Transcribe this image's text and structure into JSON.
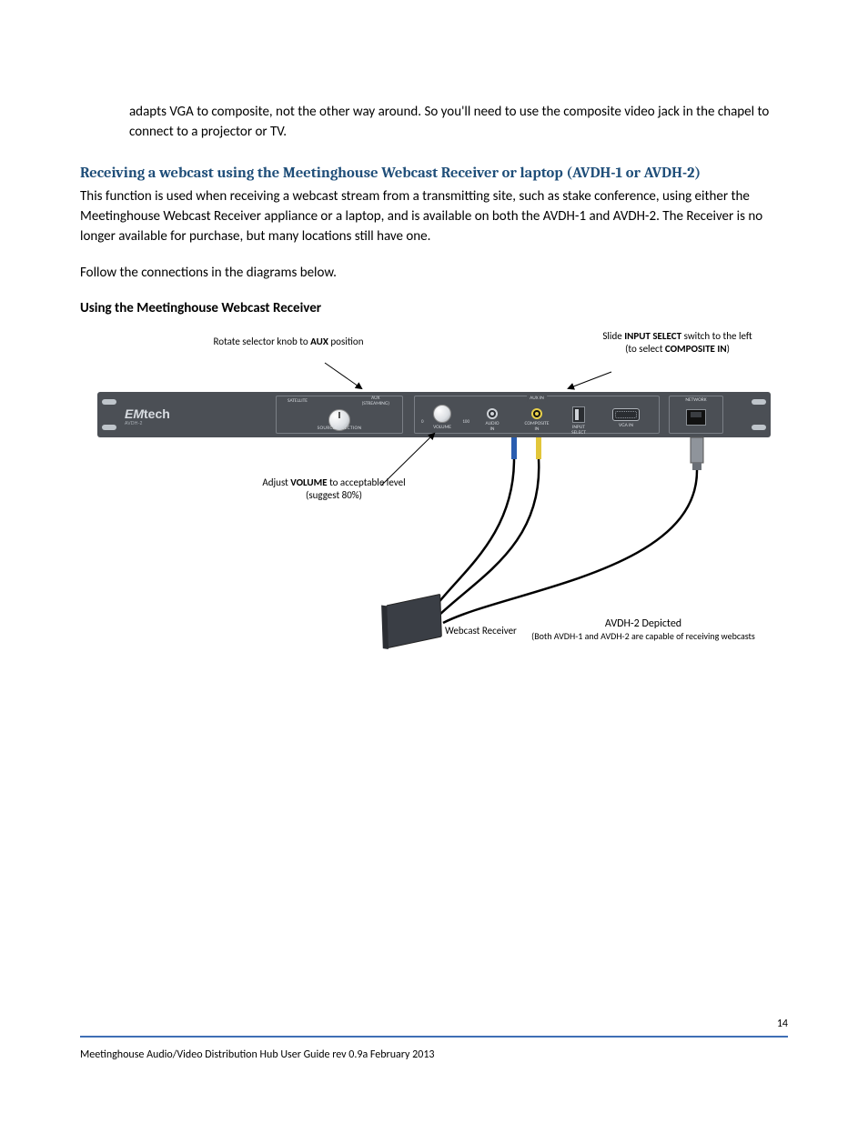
{
  "body": {
    "leadin_para": "adapts VGA to composite, not the other way around. So you'll need to use the composite video jack in the chapel to connect to a projector or TV.",
    "heading": "Receiving a webcast using the Meetinghouse Webcast Receiver or laptop (AVDH-1 or AVDH-2)",
    "para1": "This function is used when receiving a webcast stream from a transmitting site, such as stake conference, using either the Meetinghouse Webcast Receiver appliance or a laptop, and is available on both the AVDH-1 and AVDH-2. The Receiver is no longer available for purchase, but many locations still have one.",
    "para2": "Follow the connections in the diagrams below.",
    "sub_heading": "Using the Meetinghouse Webcast Receiver"
  },
  "diagram": {
    "brand_em": "EM",
    "brand_tech": "tech",
    "brand_sub": "AVDH-2",
    "callout_knob_pre": "Rotate selector knob to ",
    "callout_knob_bold": "AUX",
    "callout_knob_post": " position",
    "callout_input_pre": "Slide ",
    "callout_input_bold": "INPUT SELECT",
    "callout_input_mid": " switch to the left (to select ",
    "callout_input_bold2": "COMPOSITE IN",
    "callout_input_post": ")",
    "callout_volume_pre": "Adjust ",
    "callout_volume_bold": "VOLUME",
    "callout_volume_post": " to acceptable level (suggest 80%)",
    "receiver_label": "Webcast Receiver",
    "depicted_title": "AVDH-2 Depicted",
    "depicted_sub": "(Both AVDH-1 and AVDH-2 are capable of receiving webcasts",
    "panel": {
      "source_selection": "SOURCE SELECTION",
      "satellite": "SATELLITE",
      "aux_streaming_l1": "AUX",
      "aux_streaming_l2": "(STREAMING)",
      "aux_in": "AUX IN",
      "volume_lbl": "VOLUME",
      "tick_zero": "0",
      "tick_hundred": "100",
      "audio_in_l1": "AUDIO",
      "audio_in_l2": "IN",
      "composite_l1": "COMPOSITE",
      "composite_l2": "IN",
      "input_sel_l1": "INPUT",
      "input_sel_l2": "SELECT",
      "vga_in": "VGA IN",
      "network": "NETWORK"
    }
  },
  "footer": {
    "text": "Meetinghouse Audio/Video Distribution Hub User Guide rev 0.9a February 2013",
    "page": "14"
  }
}
